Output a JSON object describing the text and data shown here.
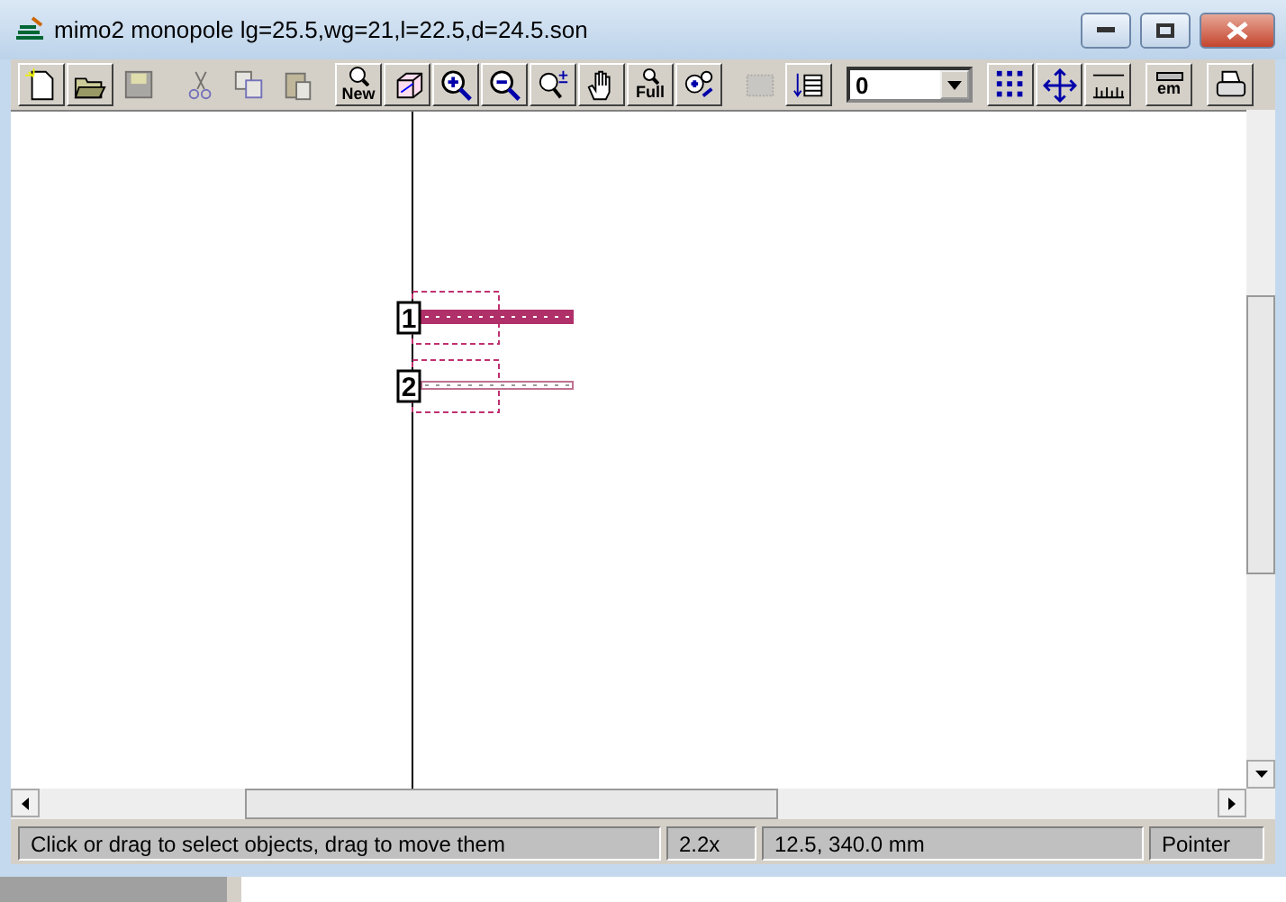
{
  "window": {
    "title": "mimo2 monopole lg=25.5,wg=21,l=22.5,d=24.5.son"
  },
  "toolbar": {
    "groups": [
      [
        {
          "kind": "new-file",
          "disabled": false
        },
        {
          "kind": "open-folder",
          "disabled": false
        },
        {
          "kind": "save",
          "disabled": true
        }
      ],
      [
        {
          "kind": "cut",
          "disabled": true
        },
        {
          "kind": "copy",
          "disabled": true
        },
        {
          "kind": "paste",
          "disabled": true
        }
      ],
      [
        {
          "kind": "zoom-new",
          "label": "New",
          "disabled": false
        },
        {
          "kind": "cube",
          "disabled": false
        },
        {
          "kind": "zoom-in",
          "disabled": false
        },
        {
          "kind": "zoom-out",
          "disabled": false
        },
        {
          "kind": "zoom-step",
          "disabled": false
        },
        {
          "kind": "hand",
          "disabled": false
        },
        {
          "kind": "zoom-full",
          "label": "Full",
          "disabled": false
        },
        {
          "kind": "zoom-fit",
          "disabled": false
        }
      ],
      [
        {
          "kind": "layer-grid",
          "disabled": true
        },
        {
          "kind": "layers",
          "disabled": false
        }
      ]
    ],
    "level_select": {
      "value": "0"
    },
    "groups_right": [
      [
        {
          "kind": "grid",
          "disabled": false
        },
        {
          "kind": "move",
          "disabled": false
        },
        {
          "kind": "ruler",
          "disabled": false
        }
      ],
      [
        {
          "kind": "em",
          "label": "em",
          "disabled": false
        }
      ],
      [
        {
          "kind": "printer",
          "disabled": false
        }
      ]
    ]
  },
  "canvas": {
    "ports": [
      {
        "label": "1",
        "selected": true
      },
      {
        "label": "2",
        "selected": false
      }
    ]
  },
  "status_bar": [
    "Click or drag to select objects, drag to move them",
    "2.2x",
    "12.5, 340.0 mm",
    "Pointer"
  ]
}
